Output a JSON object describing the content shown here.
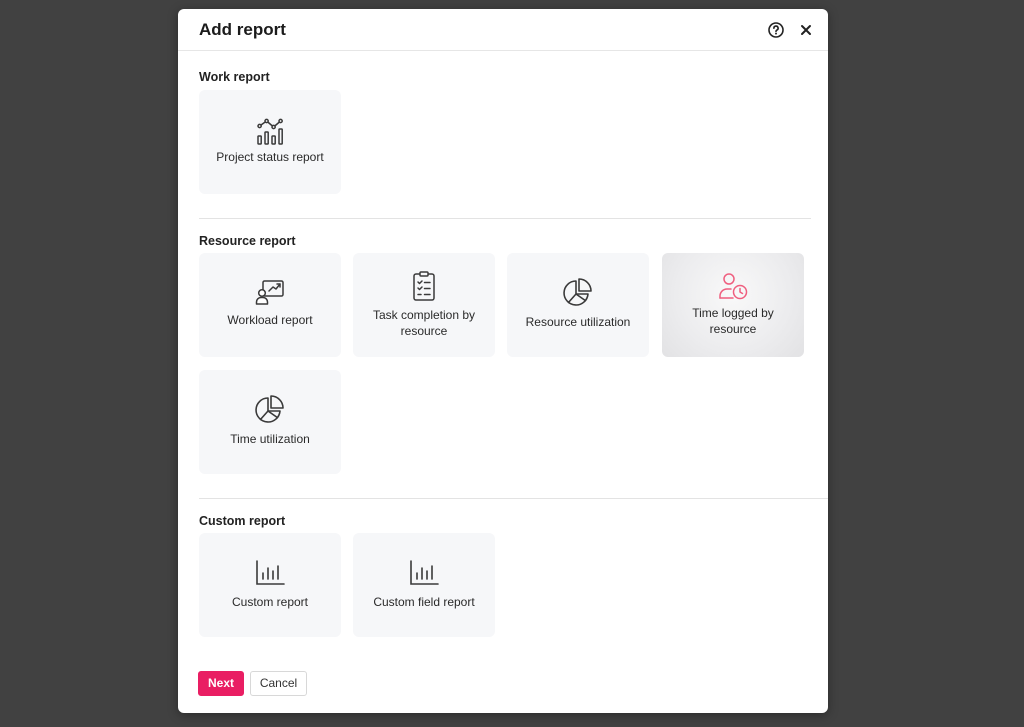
{
  "dialog": {
    "title": "Add report",
    "help_icon": "help-circle-icon",
    "close_icon": "close-icon"
  },
  "sections": {
    "work": {
      "title": "Work report",
      "cards": [
        {
          "label": "Project status report",
          "icon": "bar-line-chart-icon"
        }
      ]
    },
    "resource": {
      "title": "Resource report",
      "cards": [
        {
          "label": "Workload report",
          "icon": "presentation-user-icon"
        },
        {
          "label": "Task completion by resource",
          "icon": "clipboard-checklist-icon"
        },
        {
          "label": "Resource utilization",
          "icon": "pie-chart-icon"
        },
        {
          "label": "Time logged by resource",
          "icon": "user-clock-icon"
        },
        {
          "label": "Time utilization",
          "icon": "pie-chart-icon"
        }
      ]
    },
    "custom": {
      "title": "Custom report",
      "cards": [
        {
          "label": "Custom report",
          "icon": "bar-chart-icon"
        },
        {
          "label": "Custom field report",
          "icon": "bar-chart-icon"
        }
      ]
    }
  },
  "footer": {
    "next_label": "Next",
    "cancel_label": "Cancel"
  },
  "colors": {
    "accent": "#e91e63",
    "overlay": "#414141",
    "card_bg": "#f6f7f9",
    "icon_dark": "#3a3a3a",
    "icon_active": "#ef5f7f"
  }
}
